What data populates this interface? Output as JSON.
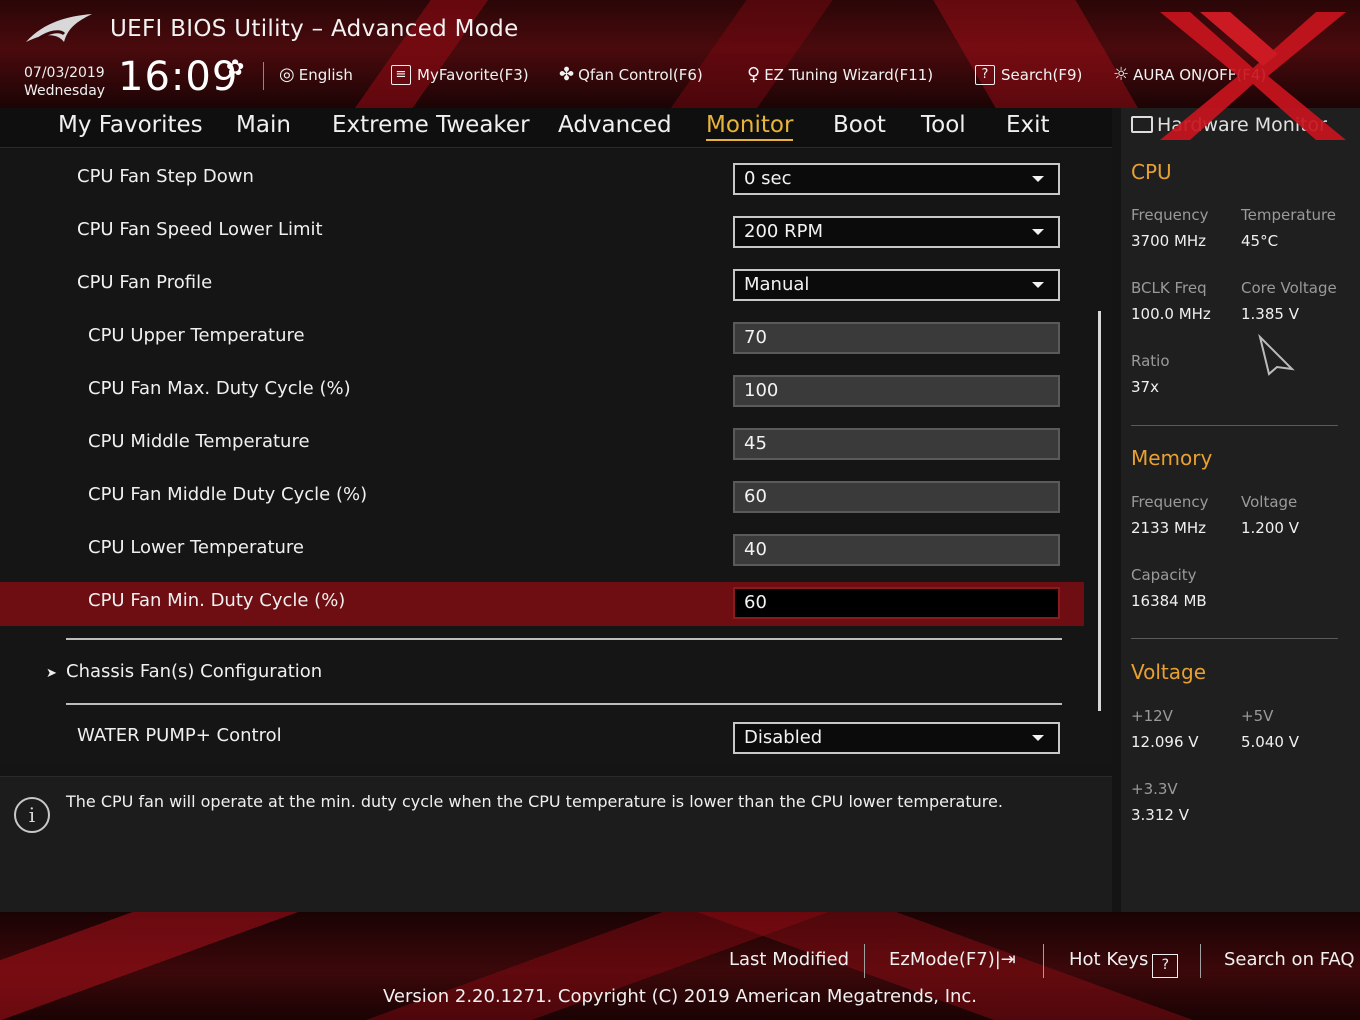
{
  "header": {
    "title": "UEFI BIOS Utility – Advanced Mode",
    "date": "07/03/2019",
    "day": "Wednesday",
    "time": "16:09",
    "toolbar": [
      {
        "label": "English",
        "icon": "globe-icon"
      },
      {
        "label": "MyFavorite(F3)",
        "icon": "favorite-list-icon"
      },
      {
        "label": "Qfan Control(F6)",
        "icon": "fan-icon"
      },
      {
        "label": "EZ Tuning Wizard(F11)",
        "icon": "lightbulb-icon"
      },
      {
        "label": "Search(F9)",
        "icon": "search-help-icon"
      },
      {
        "label": "AURA ON/OFF(F4)",
        "icon": "aura-icon"
      }
    ]
  },
  "menu": {
    "tabs": [
      "My Favorites",
      "Main",
      "Extreme Tweaker",
      "Advanced",
      "Monitor",
      "Boot",
      "Tool",
      "Exit"
    ],
    "active": "Monitor"
  },
  "settings": {
    "cpu_fan_step_down": {
      "label": "CPU Fan Step Down",
      "value": "0 sec"
    },
    "cpu_fan_speed_lower_limit": {
      "label": "CPU Fan Speed Lower Limit",
      "value": "200 RPM"
    },
    "cpu_fan_profile": {
      "label": "CPU Fan Profile",
      "value": "Manual"
    },
    "cpu_upper_temperature": {
      "label": "CPU Upper Temperature",
      "value": "70"
    },
    "cpu_fan_max_duty": {
      "label": "CPU Fan Max. Duty Cycle (%)",
      "value": "100"
    },
    "cpu_middle_temperature": {
      "label": "CPU Middle Temperature",
      "value": "45"
    },
    "cpu_fan_middle_duty": {
      "label": "CPU Fan Middle Duty Cycle (%)",
      "value": "60"
    },
    "cpu_lower_temperature": {
      "label": "CPU Lower Temperature",
      "value": "40"
    },
    "cpu_fan_min_duty": {
      "label": "CPU Fan Min. Duty Cycle (%)",
      "value": "60"
    },
    "chassis_fan_config": {
      "label": "Chassis Fan(s) Configuration"
    },
    "water_pump_control": {
      "label": "WATER PUMP+ Control",
      "value": "Disabled"
    }
  },
  "help": {
    "text": "The CPU fan will operate at the min. duty cycle when the CPU temperature is lower than the CPU lower temperature."
  },
  "hardware_monitor": {
    "title": "Hardware Monitor",
    "cpu": {
      "section": "CPU",
      "frequency_label": "Frequency",
      "frequency": "3700 MHz",
      "temperature_label": "Temperature",
      "temperature": "45°C",
      "bclk_label": "BCLK Freq",
      "bclk": "100.0 MHz",
      "core_voltage_label": "Core Voltage",
      "core_voltage": "1.385 V",
      "ratio_label": "Ratio",
      "ratio": "37x"
    },
    "memory": {
      "section": "Memory",
      "frequency_label": "Frequency",
      "frequency": "2133 MHz",
      "voltage_label": "Voltage",
      "voltage": "1.200 V",
      "capacity_label": "Capacity",
      "capacity": "16384 MB"
    },
    "voltage": {
      "section": "Voltage",
      "v12_label": "+12V",
      "v12": "12.096 V",
      "v5_label": "+5V",
      "v5": "5.040 V",
      "v33_label": "+3.3V",
      "v33": "3.312 V"
    }
  },
  "footer": {
    "last_modified": "Last Modified",
    "ezmode": "EzMode(F7)|",
    "hotkeys": "Hot Keys",
    "search_faq": "Search on FAQ",
    "version": "Version 2.20.1271. Copyright (C) 2019 American Megatrends, Inc."
  },
  "colors": {
    "accent": "#e8b33a",
    "section": "#e8a030",
    "selected_row": "#6e0e12",
    "header_red": "#4a0a0d"
  }
}
